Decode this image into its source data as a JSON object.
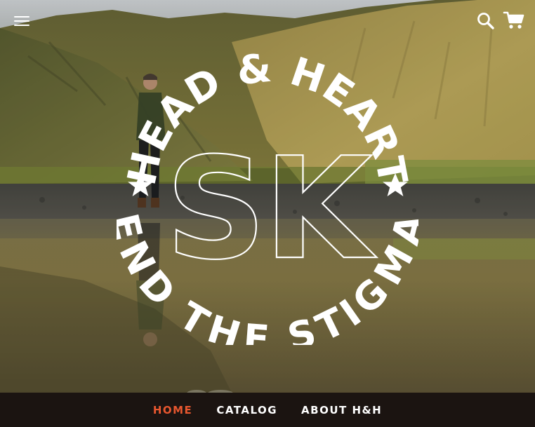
{
  "header": {
    "menu_icon": "hamburger-menu-icon",
    "search_icon": "search-icon",
    "cart_icon": "cart-icon"
  },
  "logo": {
    "top_text": "HEAD & HEART",
    "bottom_text": "END THE STIGMA",
    "monogram": "SK",
    "star_icon": "star-icon"
  },
  "nav": {
    "items": [
      {
        "label": "HOME",
        "active": true
      },
      {
        "label": "CATALOG",
        "active": false
      },
      {
        "label": "ABOUT H&H",
        "active": false
      }
    ]
  },
  "colors": {
    "nav_background": "#1b1411",
    "nav_active": "#e8572f",
    "nav_text": "#ffffff",
    "logo_white": "#ffffff"
  }
}
